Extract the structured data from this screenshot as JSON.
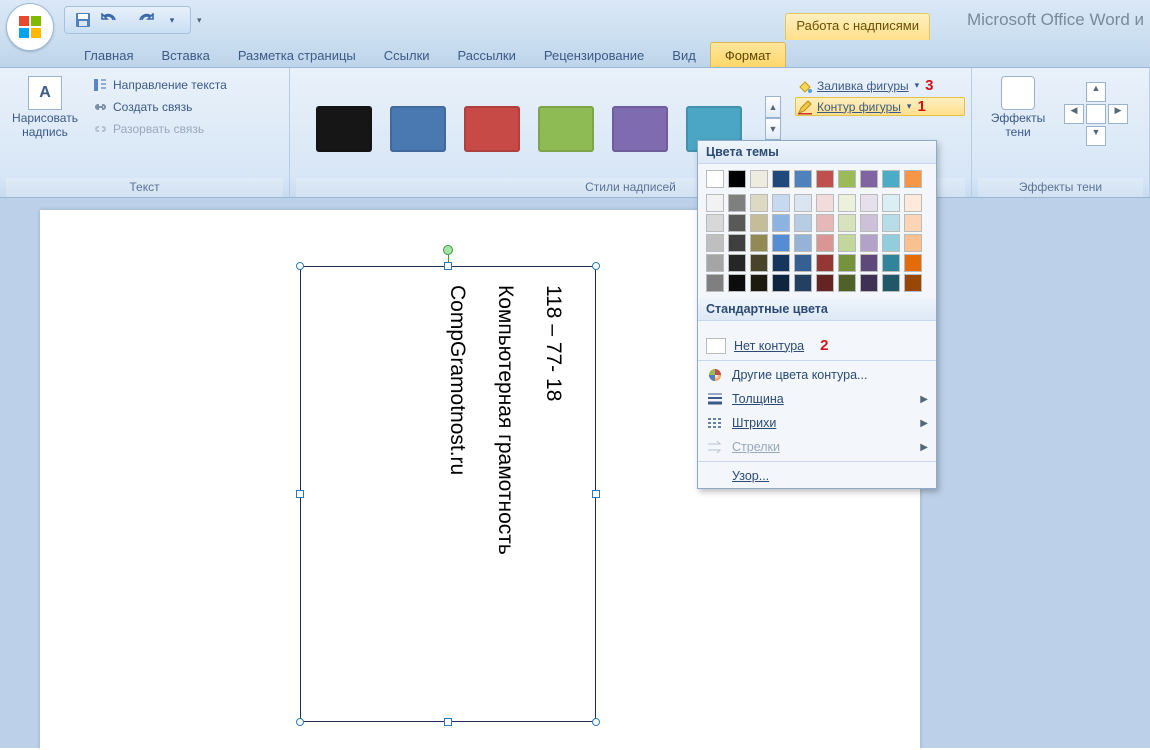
{
  "titlebar": {
    "contextual_label": "Работа с надписями",
    "app_title": "Microsoft Office Word и"
  },
  "tabs": [
    "Главная",
    "Вставка",
    "Разметка страницы",
    "Ссылки",
    "Рассылки",
    "Рецензирование",
    "Вид",
    "Формат"
  ],
  "active_tab_index": 7,
  "ribbon": {
    "text_group": {
      "label": "Текст",
      "draw_textbox": "Нарисовать\nнадпись",
      "direction": "Направление текста",
      "create_link": "Создать связь",
      "break_link": "Разорвать связь"
    },
    "styles_group": {
      "label": "Стили надписей",
      "swatches": [
        "#161616",
        "#4a78b1",
        "#c74a47",
        "#8fbb54",
        "#7e6bb0",
        "#4aa6c4"
      ],
      "shape_fill": "Заливка фигуры",
      "shape_outline": "Контур фигуры",
      "anno_fill": "3",
      "anno_outline": "1"
    },
    "shadow_group": {
      "label": "Эффекты тени",
      "effects": "Эффекты\nтени"
    }
  },
  "dropdown": {
    "theme_head": "Цвета темы",
    "theme_colors_row1": [
      "#ffffff",
      "#000000",
      "#eeece1",
      "#1f497d",
      "#4f81bd",
      "#c0504d",
      "#9bbb59",
      "#8064a2",
      "#4bacc6",
      "#f79646"
    ],
    "theme_tints": [
      [
        "#f2f2f2",
        "#7f7f7f",
        "#ddd9c3",
        "#c6d9f0",
        "#dbe5f1",
        "#f2dcdb",
        "#ebf1dd",
        "#e5e0ec",
        "#dbeef3",
        "#fdeada"
      ],
      [
        "#d8d8d8",
        "#595959",
        "#c4bd97",
        "#8db3e2",
        "#b8cce4",
        "#e5b9b7",
        "#d7e3bc",
        "#ccc1d9",
        "#b7dde8",
        "#fbd5b5"
      ],
      [
        "#bfbfbf",
        "#3f3f3f",
        "#938953",
        "#548dd4",
        "#95b3d7",
        "#d99694",
        "#c3d69b",
        "#b2a2c7",
        "#92cddc",
        "#fac08f"
      ],
      [
        "#a5a5a5",
        "#262626",
        "#494429",
        "#17365d",
        "#366092",
        "#953734",
        "#76923c",
        "#5f497a",
        "#31859b",
        "#e36c09"
      ],
      [
        "#7f7f7f",
        "#0c0c0c",
        "#1d1b10",
        "#0f243e",
        "#244061",
        "#632423",
        "#4f6128",
        "#3f3151",
        "#205867",
        "#974806"
      ]
    ],
    "standard_head": "Стандартные цвета",
    "standard_colors": [
      "#c00000",
      "#ff0000",
      "#ffc000",
      "#ffff00",
      "#92d050",
      "#00b050",
      "#00b0f0",
      "#0070c0",
      "#002060",
      "#7030a0"
    ],
    "no_outline": "Нет контура",
    "anno_no_outline": "2",
    "more_colors": "Другие цвета контура...",
    "weight": "Толщина",
    "dashes": "Штрихи",
    "arrows": "Стрелки",
    "pattern": "Узор..."
  },
  "document": {
    "line1": "118 – 77- 18",
    "line2": "Компьютерная грамотность",
    "line3": "CompGramotnost.ru"
  }
}
